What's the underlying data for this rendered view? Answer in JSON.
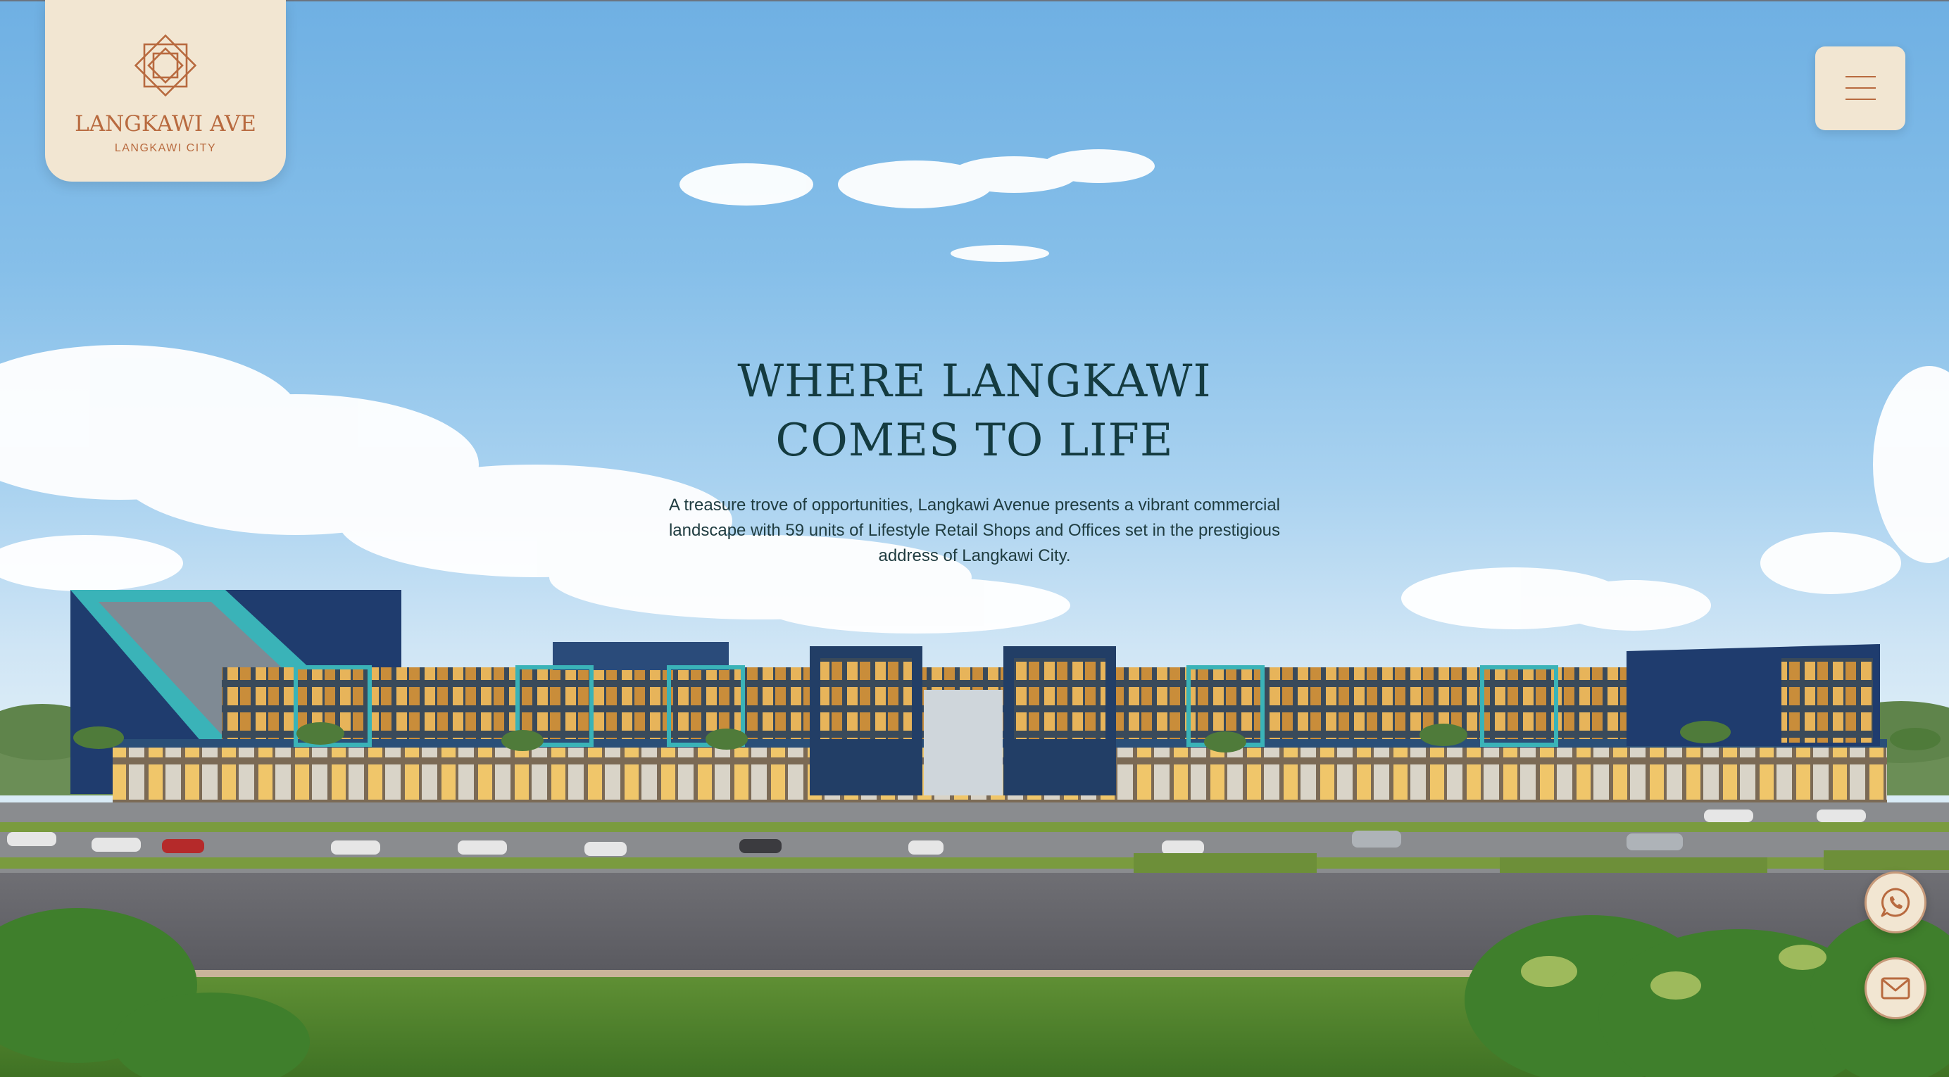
{
  "brand": {
    "name": "LANGKAWI AVE",
    "subtitle": "LANGKAWI CITY",
    "logo_icon": "star-knot-icon"
  },
  "header": {
    "menu_icon": "hamburger-icon"
  },
  "hero": {
    "title_line1": "WHERE LANGKAWI",
    "title_line2": "COMES TO LIFE",
    "description": "A treasure trove of opportunities, Langkawi Avenue presents a vibrant commercial landscape with 59 units of Lifestyle Retail Shops and Offices set in the prestigious address of Langkawi City."
  },
  "contact": {
    "whatsapp_icon": "whatsapp-icon",
    "email_icon": "mail-icon"
  },
  "colors": {
    "accent": "#b86a3f",
    "card_bg": "#f2e6d2",
    "title": "#143b40"
  }
}
